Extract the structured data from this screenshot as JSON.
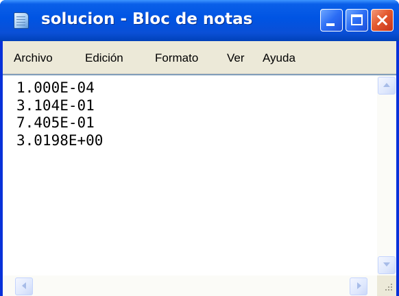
{
  "window": {
    "title": "solucion - Bloc de notas",
    "icon": "notepad-icon"
  },
  "title_buttons": {
    "minimize": "minimize-icon",
    "maximize": "maximize-icon",
    "close": "close-icon"
  },
  "menu": {
    "items": [
      "Archivo",
      "Edición",
      "Formato",
      "Ver",
      "Ayuda"
    ]
  },
  "editor": {
    "lines": [
      "1.000E-04",
      "3.104E-01",
      "7.405E-01",
      "3.0198E+00"
    ]
  },
  "colors": {
    "titlebar": "#0054e3",
    "menubar": "#ece9d8",
    "close_button": "#e45a2f"
  }
}
